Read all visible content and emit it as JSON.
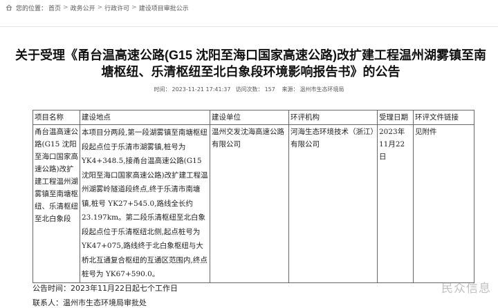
{
  "breadcrumb": {
    "prefix": "您的位置：",
    "items": [
      "首页",
      "政务公开",
      "行政许可",
      "建设项目审批公示"
    ],
    "separator": ">"
  },
  "title": "关于受理《甬台温高速公路(G15 沈阳至海口国家高速公路)改扩建工程温州湖雾镇至南塘枢纽、乐清枢纽至北白象段环境影响报告书》的公告",
  "meta": {
    "time_label": "时间：",
    "time": "2023-11-21 17:41:37",
    "views_label": "访问次数：",
    "views": "157",
    "source_label": "来源：",
    "source": "温州市生态环境局"
  },
  "table": {
    "headers": [
      "项目名称",
      "建设地点",
      "建设单位",
      "环评机构",
      "受理日期",
      "环评文件链接"
    ],
    "row": {
      "name": "甬台温高速公路(G15 沈阳至海口国家高速公路)改扩建工程温州湖雾镇至南塘枢纽、乐清枢纽至北白象段",
      "location": "本项目分两段,第一段湖雾镇至南塘枢纽段起点位于乐清市湖雾镇,桩号为 YK4+348.5,接甬台温高速公路(G15 沈阳至海口国家高速公路)改扩建工程温州湖雾岭隧道段终点,终于乐清市南塘镇,桩号 YK27+545.0,路线全长约 23.197km。第二段乐清枢纽至北白象段起点位于乐清枢纽北侧,起点桩号为 YK47+075,路线终于北白象枢纽与大桥北互通复合枢纽的互通区范围内,终点桩号为 YK67+590.0。",
      "builder": "温州交发沈海高速公路有限公司",
      "agency": "河海生态环境技术（浙江）有限公司",
      "date": "2023年11月22日",
      "link": "见附件"
    }
  },
  "footer": {
    "period_label": "公告时间：",
    "period": "2023年11月22日起七个工作日",
    "contact_label": "联系人：",
    "contact": "温州市生态环境局审批处"
  },
  "watermark": "民众信息",
  "colors": {
    "text": "#333333",
    "title": "#111111",
    "border": "#666666"
  },
  "icons": {
    "breadcrumb": "home-icon"
  }
}
